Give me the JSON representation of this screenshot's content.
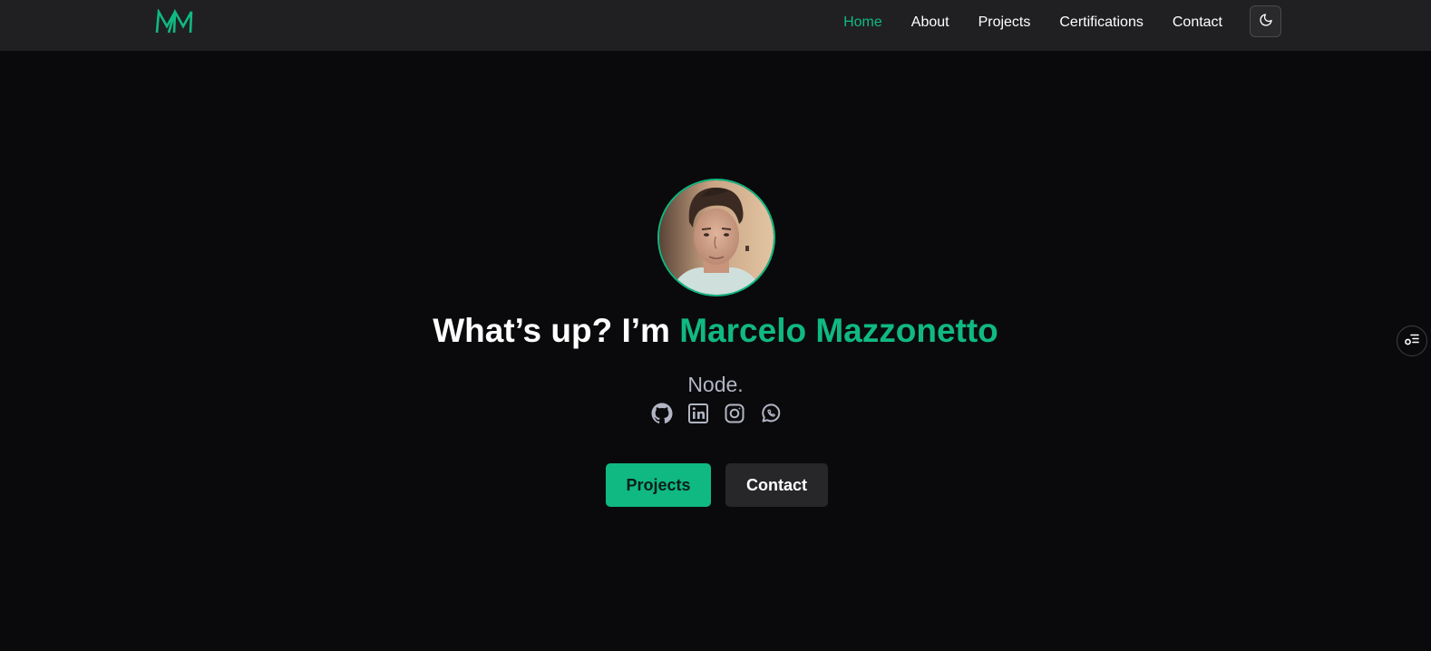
{
  "brand": {
    "logo_text": "MM",
    "accent_color": "#10b981"
  },
  "nav": {
    "items": [
      {
        "label": "Home",
        "active": true
      },
      {
        "label": "About"
      },
      {
        "label": "Projects"
      },
      {
        "label": "Certifications"
      },
      {
        "label": "Contact"
      }
    ],
    "theme_toggle_icon": "moon-icon"
  },
  "hero": {
    "avatar_icon": "profile-photo",
    "greeting": "What’s up? I’m ",
    "name": "Marcelo Mazzonetto",
    "role_text": "Node.",
    "socials": [
      {
        "icon": "github-icon"
      },
      {
        "icon": "linkedin-icon"
      },
      {
        "icon": "instagram-icon"
      },
      {
        "icon": "whatsapp-icon"
      }
    ],
    "buttons": {
      "primary_label": "Projects",
      "secondary_label": "Contact"
    }
  },
  "floating": {
    "icon": "floating-menu-icon"
  }
}
